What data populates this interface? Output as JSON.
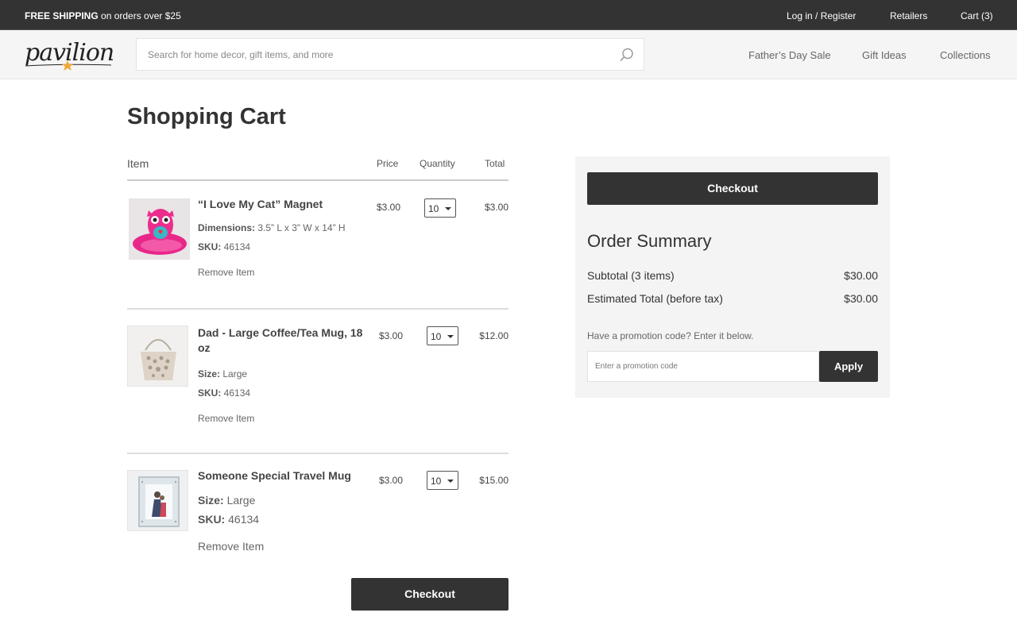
{
  "topbar": {
    "shipping_bold": "FREE SHIPPING",
    "shipping_rest": " on orders over $25",
    "login": "Log in / Register",
    "retailers": "Retailers",
    "cart": "Cart (3)"
  },
  "header": {
    "logo_text": "pavilion",
    "search_placeholder": "Search for home decor, gift items, and more",
    "search_icon": "search-icon",
    "nav": [
      "Father’s Day Sale",
      "Gift Ideas",
      "Collections"
    ]
  },
  "page_title": "Shopping Cart",
  "table_headers": {
    "item": "Item",
    "price": "Price",
    "quantity": "Quantity",
    "total": "Total"
  },
  "cart_items": [
    {
      "name": "“I Love My Cat” Magnet",
      "attr1_label": "Dimensions:",
      "attr1_value": " 3.5” L x 3” W x 14” H",
      "attr2_label": "SKU:",
      "attr2_value": " 46134",
      "remove": "Remove Item",
      "price": "$3.00",
      "quantity": "10",
      "total": "$3.00",
      "image_icon": "owl-pillow-image"
    },
    {
      "name": "Dad - Large Coffee/Tea Mug, 18 oz",
      "attr1_label": "Size:",
      "attr1_value": " Large",
      "attr2_label": "SKU:",
      "attr2_value": " 46134",
      "remove": "Remove Item",
      "price": "$3.00",
      "quantity": "10",
      "total": "$12.00",
      "image_icon": "handbag-image"
    },
    {
      "name": "Someone Special Travel Mug",
      "attr1_label": "Size:",
      "attr1_value": " Large",
      "attr2_label": "SKU:",
      "attr2_value": " 46134",
      "remove": "Remove Item",
      "price": "$3.00",
      "quantity": "10",
      "total": "$15.00",
      "image_icon": "photo-frame-image"
    }
  ],
  "checkout_label": "Checkout",
  "summary": {
    "checkout_label": "Checkout",
    "title": "Order Summary",
    "subtotal_label": "Subtotal (3 items)",
    "subtotal_value": "$30.00",
    "estimated_label": "Estimated Total (before tax)",
    "estimated_value": "$30.00",
    "promo_label": "Have a promotion code? Enter it below.",
    "promo_placeholder": "Enter a promotion code",
    "apply_label": "Apply"
  },
  "colors": {
    "dark": "#333333",
    "accent_star": "#f0a830",
    "summary_bg": "#f4f4f4"
  }
}
